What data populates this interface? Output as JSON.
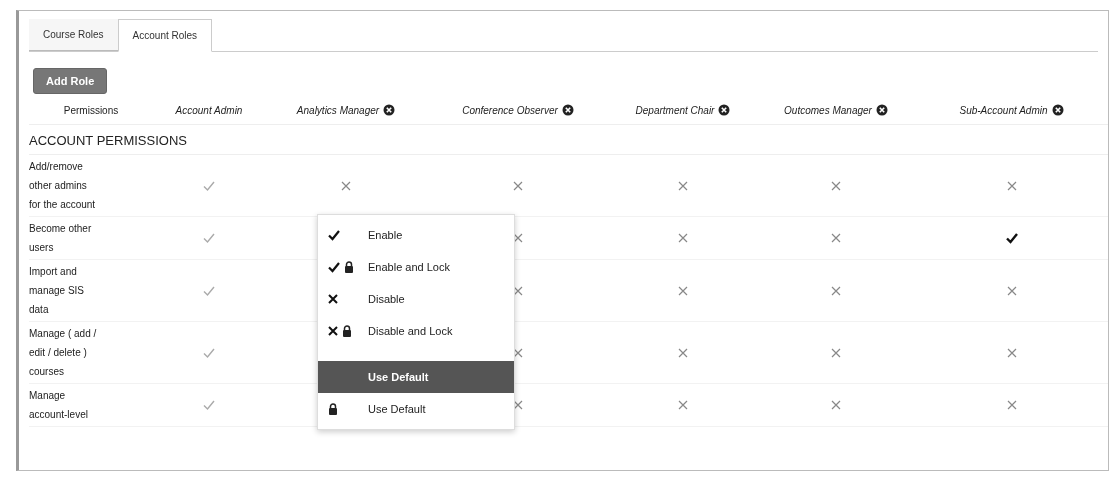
{
  "tabs": [
    {
      "label": "Course Roles",
      "selected": false
    },
    {
      "label": "Account Roles",
      "selected": true
    }
  ],
  "add_button": "Add Role",
  "table": {
    "columns": [
      {
        "label": "Permissions",
        "kind": "plain",
        "removable": false
      },
      {
        "label": "Account Admin",
        "kind": "role",
        "removable": false
      },
      {
        "label": "Analytics Manager",
        "kind": "role",
        "removable": true
      },
      {
        "label": "Conference Observer",
        "kind": "role",
        "removable": true
      },
      {
        "label": "Department Chair",
        "kind": "role",
        "removable": true
      },
      {
        "label": "Outcomes Manager",
        "kind": "role",
        "removable": true
      },
      {
        "label": "Sub-Account Admin",
        "kind": "role",
        "removable": true
      }
    ],
    "section": "ACCOUNT PERMISSIONS",
    "rows": [
      {
        "permission": [
          "Add/remove",
          "other admins",
          "for the account"
        ],
        "cells": [
          {
            "enabled": true,
            "overridden": false
          },
          {
            "enabled": false,
            "overridden": false
          },
          {
            "enabled": false,
            "overridden": false
          },
          {
            "enabled": false,
            "overridden": false
          },
          {
            "enabled": false,
            "overridden": false
          },
          {
            "enabled": false,
            "overridden": false
          }
        ]
      },
      {
        "permission": [
          "Become other",
          "users"
        ],
        "cells": [
          {
            "enabled": true,
            "overridden": false
          },
          null,
          {
            "enabled": false,
            "overridden": false
          },
          {
            "enabled": false,
            "overridden": false
          },
          {
            "enabled": false,
            "overridden": false
          },
          {
            "enabled": true,
            "overridden": true
          }
        ]
      },
      {
        "permission": [
          "Import and",
          "manage SIS",
          "data"
        ],
        "cells": [
          {
            "enabled": true,
            "overridden": false
          },
          null,
          {
            "enabled": false,
            "overridden": false
          },
          {
            "enabled": false,
            "overridden": false
          },
          {
            "enabled": false,
            "overridden": false
          },
          {
            "enabled": false,
            "overridden": false
          }
        ]
      },
      {
        "permission": [
          "Manage ( add /",
          "edit / delete )",
          "courses"
        ],
        "cells": [
          {
            "enabled": true,
            "overridden": false
          },
          null,
          {
            "enabled": false,
            "overridden": false
          },
          {
            "enabled": false,
            "overridden": false
          },
          {
            "enabled": false,
            "overridden": false
          },
          {
            "enabled": false,
            "overridden": false
          }
        ]
      },
      {
        "permission": [
          "Manage",
          "account-level"
        ],
        "cells": [
          {
            "enabled": true,
            "overridden": false
          },
          null,
          {
            "enabled": false,
            "overridden": false
          },
          {
            "enabled": false,
            "overridden": false
          },
          {
            "enabled": false,
            "overridden": false
          },
          {
            "enabled": false,
            "overridden": false
          }
        ]
      }
    ]
  },
  "menu": {
    "items": [
      {
        "kind": "enable",
        "label": "Enable",
        "selected": false
      },
      {
        "kind": "enable_lock",
        "label": "Enable and Lock",
        "selected": false
      },
      {
        "kind": "disable",
        "label": "Disable",
        "selected": false
      },
      {
        "kind": "disable_lock",
        "label": "Disable and Lock",
        "selected": false
      },
      {
        "kind": "gap"
      },
      {
        "kind": "default",
        "label": "Use Default",
        "selected": true
      },
      {
        "kind": "default_lock",
        "label": "Use Default",
        "selected": false
      }
    ]
  }
}
